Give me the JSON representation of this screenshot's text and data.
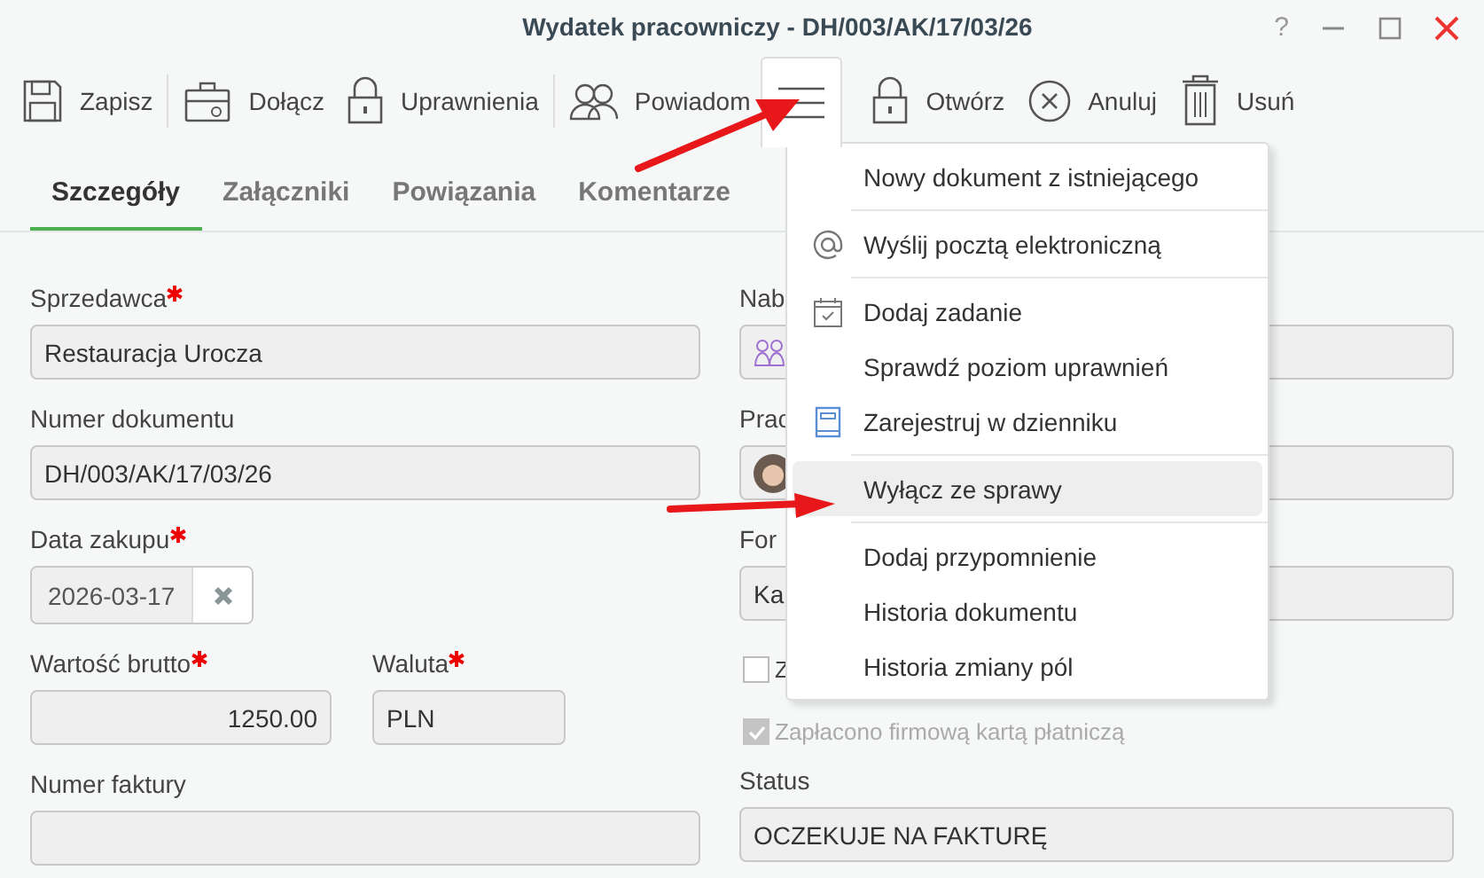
{
  "window": {
    "title": "Wydatek pracowniczy - DH/003/AK/17/03/26",
    "help": "?"
  },
  "toolbar": [
    {
      "label": "Zapisz",
      "kind": "floppy",
      "selected": false
    },
    {
      "kind": "separator"
    },
    {
      "label": "Dołącz",
      "kind": "briefcase",
      "selected": false
    },
    {
      "label": "Uprawnienia",
      "kind": "lock",
      "selected": false
    },
    {
      "kind": "separator"
    },
    {
      "label": "Powiadom",
      "kind": "people",
      "selected": false
    },
    {
      "kind": "menu",
      "selected": true
    },
    {
      "label": "Otwórz",
      "kind": "lock",
      "selected": false
    },
    {
      "label": "Anuluj",
      "kind": "cancel",
      "selected": false
    },
    {
      "label": "Usuń",
      "kind": "trash",
      "selected": false
    }
  ],
  "tabs": [
    {
      "label": "Szczegóły",
      "selected": true
    },
    {
      "label": "Załączniki",
      "selected": false
    },
    {
      "label": "Powiązania",
      "selected": false
    },
    {
      "label": "Komentarze",
      "selected": false
    }
  ],
  "left_fields": [
    {
      "label": "Sprzedawca",
      "required": true,
      "kind": "text",
      "value": "Restauracja Urocza"
    },
    {
      "label": "Numer dokumentu",
      "required": false,
      "kind": "text",
      "value": "DH/003/AK/17/03/26"
    },
    {
      "label": "Data zakupu",
      "required": true,
      "kind": "date",
      "value": "2026-03-17"
    },
    {
      "label": "Wartość brutto",
      "required": true,
      "kind": "amount",
      "value": "1250.00",
      "currency_label": "Waluta",
      "currency_required": true,
      "currency": "PLN"
    },
    {
      "label": "Numer faktury",
      "required": false,
      "kind": "text"
    }
  ],
  "right_fields": [
    {
      "label": "Nab",
      "kind": "group"
    },
    {
      "label": "Prac",
      "kind": "person"
    },
    {
      "label": "For",
      "kind": "text",
      "value": "Ka"
    },
    {
      "kind": "checks",
      "items": [
        {
          "label": "Z",
          "checked": false,
          "disabled": false
        },
        {
          "label": "Zapłacono firmową kartą płatniczą",
          "checked": true,
          "disabled": true
        }
      ]
    },
    {
      "label": "Status",
      "kind": "text",
      "value": "OCZEKUJE NA FAKTURĘ"
    }
  ],
  "menu": [
    {
      "label": "Nowy dokument z istniejącego",
      "kind": "plain",
      "selected": false
    },
    {
      "kind": "separator"
    },
    {
      "label": "Wyślij pocztą elektroniczną",
      "kind": "at",
      "selected": false
    },
    {
      "kind": "separator"
    },
    {
      "label": "Dodaj zadanie",
      "kind": "calendar",
      "selected": false
    },
    {
      "label": "Sprawdź poziom uprawnień",
      "kind": "plain",
      "selected": false
    },
    {
      "label": "Zarejestruj w dzienniku",
      "kind": "book",
      "selected": false
    },
    {
      "kind": "separator"
    },
    {
      "label": "Wyłącz ze sprawy",
      "kind": "plain",
      "selected": true
    },
    {
      "kind": "separator"
    },
    {
      "label": "Dodaj przypomnienie",
      "kind": "plain",
      "selected": false
    },
    {
      "label": "Historia dokumentu",
      "kind": "plain",
      "selected": false
    },
    {
      "label": "Historia zmiany pól",
      "kind": "plain",
      "selected": false
    }
  ]
}
